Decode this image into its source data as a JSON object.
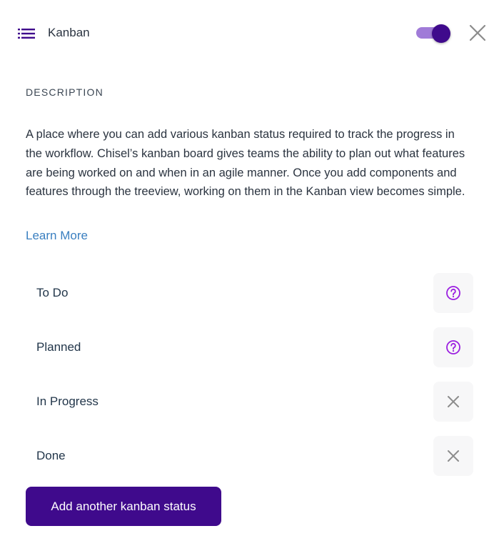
{
  "header": {
    "icon": "list-icon",
    "title": "Kanban",
    "toggle_on": true,
    "close_icon": "close-icon"
  },
  "description": {
    "label": "DESCRIPTION",
    "text": "A place where you can add various kanban status required to track the progress in the workflow. Chisel’s kanban board gives teams the ability to plan out what features are being worked on and when in an agile manner. Once you add components and features through the treeview, working on them in the Kanban view becomes simple.",
    "learn_more": "Learn More"
  },
  "statuses": [
    {
      "label": "To Do",
      "action_icon": "help-icon"
    },
    {
      "label": "Planned",
      "action_icon": "help-icon"
    },
    {
      "label": "In Progress",
      "action_icon": "close-icon"
    },
    {
      "label": "Done",
      "action_icon": "close-icon"
    }
  ],
  "add_button": {
    "label": "Add another kanban status"
  },
  "colors": {
    "primary": "#3f0a8c",
    "toggle_track": "#a07bd8",
    "help_icon": "#9b1fe0",
    "link": "#3a7fc0",
    "close_icon": "#8c8c8c"
  }
}
